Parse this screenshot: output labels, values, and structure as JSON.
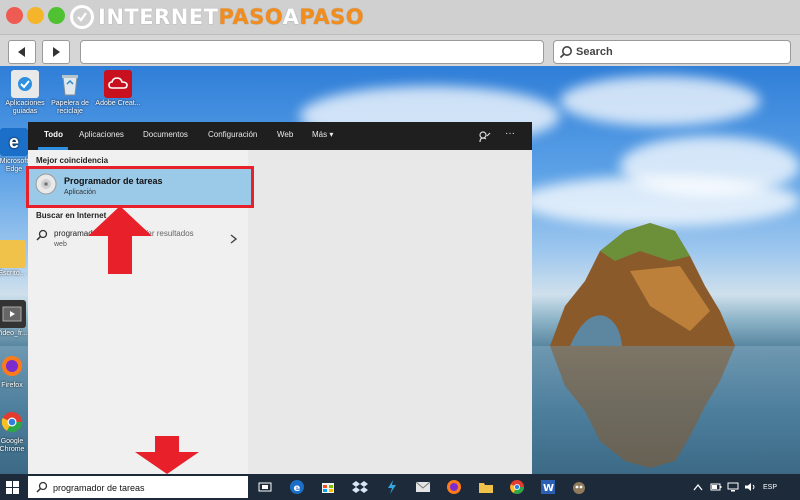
{
  "site": {
    "logo_part1": "INTERNET",
    "logo_part2": "PASO",
    "logo_part3": "A",
    "logo_part4": "PASO"
  },
  "browser": {
    "search_label": "Search"
  },
  "desktop_icons": [
    {
      "label": "Aplicaciones guiadas"
    },
    {
      "label": "Papelera de reciclaje"
    },
    {
      "label": "Adobe Creat..."
    },
    {
      "label": "Microsoft Edge"
    },
    {
      "label": "Escrito..."
    },
    {
      "label": "Video_fr..."
    },
    {
      "label": "Firefox"
    },
    {
      "label": "Google Chrome"
    }
  ],
  "start_menu": {
    "tabs": [
      "Todo",
      "Aplicaciones",
      "Documentos",
      "Configuración",
      "Web",
      "Más"
    ],
    "best_match_heading": "Mejor coincidencia",
    "best_match": {
      "title": "Programador de tareas",
      "subtitle": "Aplicación"
    },
    "web_heading": "Buscar en Internet",
    "web_result": {
      "query": "programador de tareas",
      "suffix": " - Ver resultados",
      "sub": "web"
    },
    "more": "···"
  },
  "taskbar": {
    "search_value": "programador de tareas",
    "language": "ESP"
  },
  "colors": {
    "highlight_border": "#e8202a",
    "arrow": "#e8202a",
    "selected_bg": "#9bc9e8"
  }
}
